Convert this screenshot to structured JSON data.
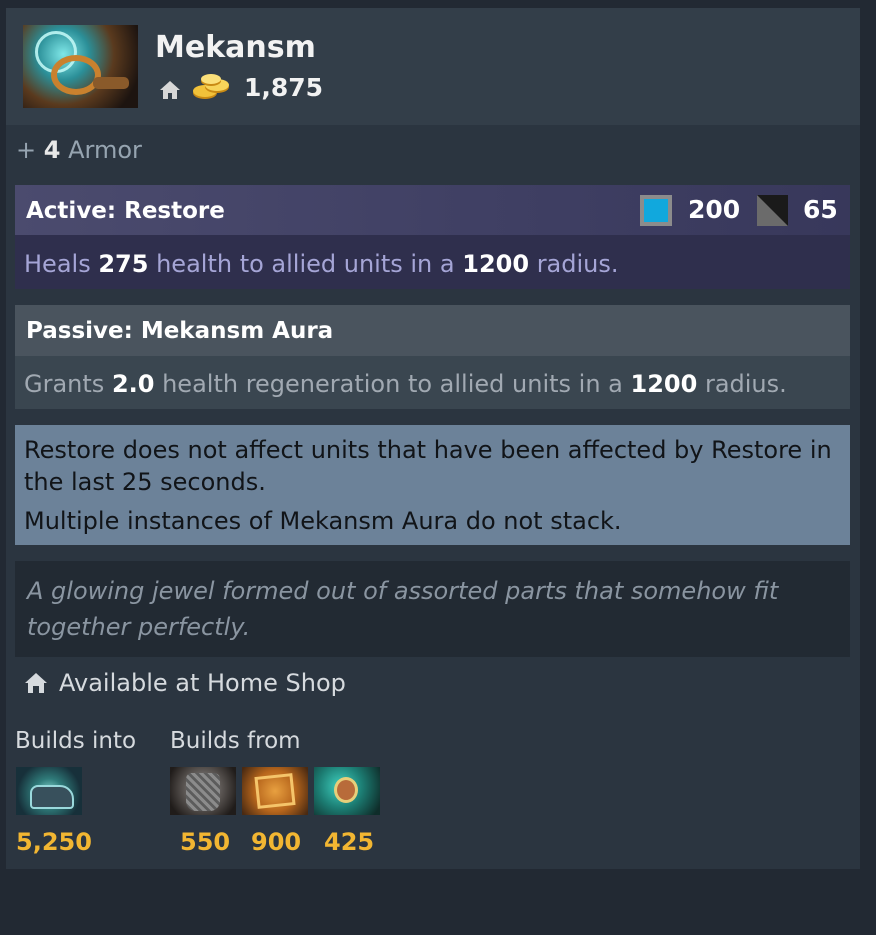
{
  "item": {
    "name": "Mekansm",
    "cost": "1,875",
    "icon": "mekansm-item-image"
  },
  "stats": {
    "plus": "+",
    "armor_value": "4",
    "armor_label": "Armor"
  },
  "active": {
    "title": "Active: Restore",
    "mana_cost": "200",
    "cooldown": "65",
    "desc_1": "Heals",
    "heal": "275",
    "desc_2": "health to allied units in a",
    "radius": "1200",
    "desc_3": "radius."
  },
  "passive": {
    "title": "Passive: Mekansm Aura",
    "desc_1": "Grants",
    "regen": "2.0",
    "desc_2": "health regeneration to allied units in a",
    "radius": "1200",
    "desc_3": "radius."
  },
  "notes": {
    "note_1": "Restore does not affect units that have been affected by Restore in the last 25 seconds.",
    "note_2": "Multiple instances of Mekansm Aura do not stack."
  },
  "lore": "A glowing jewel formed out of assorted parts that somehow fit together perfectly.",
  "availability": "Available at Home Shop",
  "builds": {
    "into_label": "Builds into",
    "from_label": "Builds from",
    "into": [
      {
        "icon": "guardian-greaves-item",
        "price": "5,250"
      }
    ],
    "from": [
      {
        "icon": "chainmail-item",
        "price": "550"
      },
      {
        "icon": "recipe-scroll-item",
        "price": "900"
      },
      {
        "icon": "headdress-item",
        "price": "425"
      }
    ]
  },
  "colors": {
    "gold": "#f2b632",
    "mana": "#11a8dd",
    "active_bg": "#2f2f4d",
    "notes_bg": "#6c8299"
  }
}
